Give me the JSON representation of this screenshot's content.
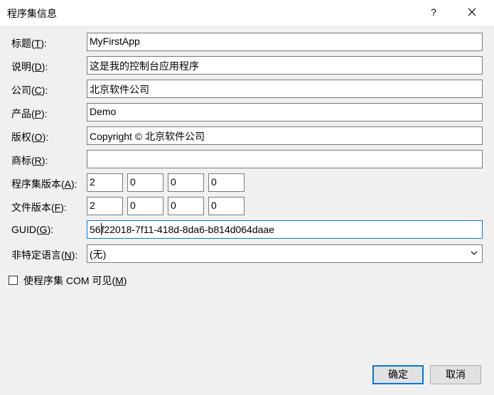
{
  "dialog": {
    "title": "程序集信息",
    "help_label": "?"
  },
  "fields": {
    "title": {
      "label_pre": "标题(",
      "accel": "T",
      "label_post": "):",
      "value": "MyFirstApp"
    },
    "description": {
      "label_pre": "说明(",
      "accel": "D",
      "label_post": "):",
      "value": "这是我的控制台应用程序"
    },
    "company": {
      "label_pre": "公司(",
      "accel": "C",
      "label_post": "):",
      "value": "北京软件公司"
    },
    "product": {
      "label_pre": "产品(",
      "accel": "P",
      "label_post": "):",
      "value": "Demo"
    },
    "copyright": {
      "label_pre": "版权(",
      "accel": "O",
      "label_post": "):",
      "value": "Copyright ©  北京软件公司"
    },
    "trademark": {
      "label_pre": "商标(",
      "accel": "R",
      "label_post": "):",
      "value": ""
    },
    "assembly_version": {
      "label_pre": "程序集版本(",
      "accel": "A",
      "label_post": "):",
      "parts": [
        "2",
        "0",
        "0",
        "0"
      ]
    },
    "file_version": {
      "label_pre": "文件版本(",
      "accel": "F",
      "label_post": "):",
      "parts": [
        "2",
        "0",
        "0",
        "0"
      ]
    },
    "guid": {
      "label_pre": "GUID(",
      "accel": "G",
      "label_post": "):",
      "value_before_caret": "56",
      "value_after_caret": "f22018-7f11-418d-8da6-b814d064daae"
    },
    "neutral_language": {
      "label_pre": "非特定语言(",
      "accel": "N",
      "label_post": "):",
      "value": "(无)"
    }
  },
  "com_visible": {
    "label_pre": "使程序集 COM 可见(",
    "accel": "M",
    "label_post": ")",
    "checked": false
  },
  "buttons": {
    "ok": "确定",
    "cancel": "取消"
  },
  "colors": {
    "focus_border": "#0078d7",
    "client_bg": "#f0f0f0"
  },
  "icons": {
    "close": "close-icon",
    "dropdown": "chevron-down-icon"
  }
}
